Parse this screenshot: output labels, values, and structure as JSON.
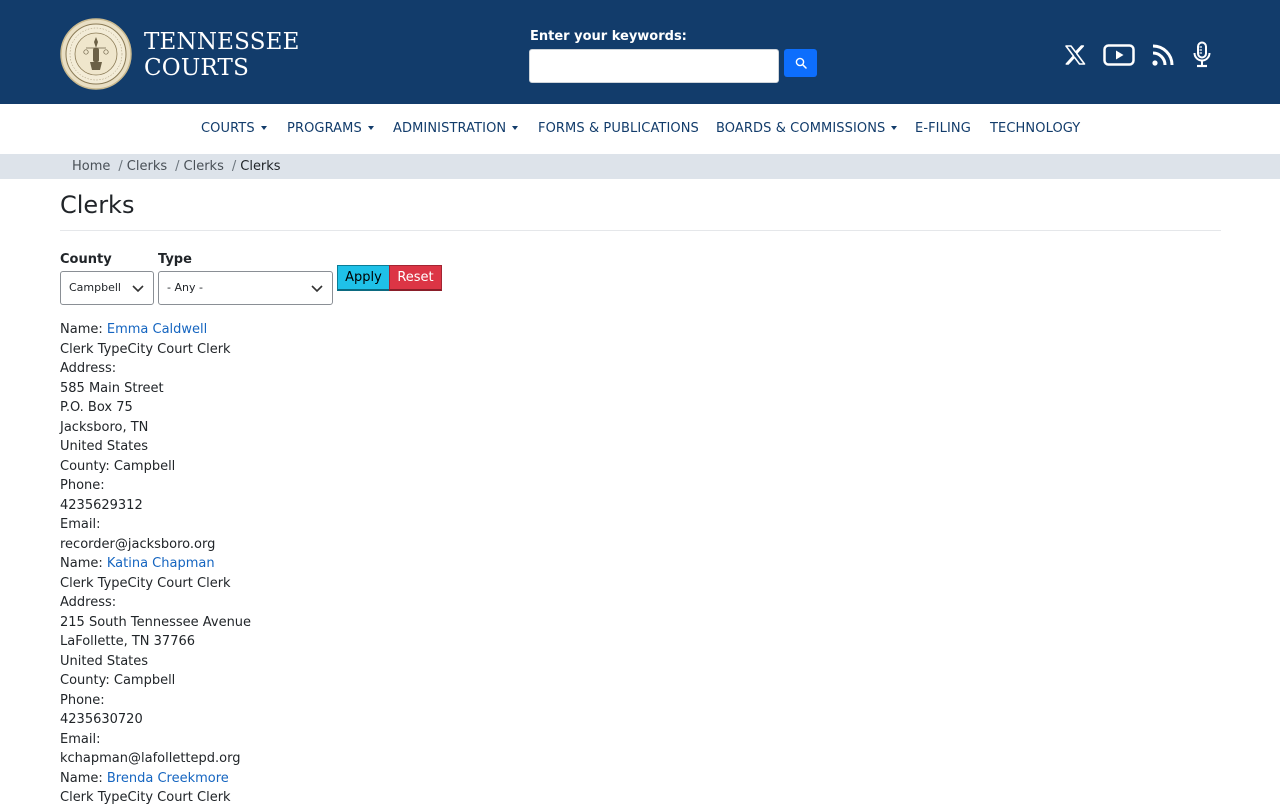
{
  "header": {
    "seal_icon": "tennessee-judiciary-seal",
    "brand_line1": "TENNESSEE",
    "brand_line2": "COURTS",
    "search_label": "Enter your keywords:",
    "search_value": "",
    "search_icon": "search-icon",
    "social_icons": [
      "x-icon",
      "youtube-icon",
      "rss-icon",
      "podcast-icon"
    ]
  },
  "nav": {
    "items": [
      {
        "label": "COURTS",
        "dropdown": true
      },
      {
        "label": "PROGRAMS",
        "dropdown": true
      },
      {
        "label": "ADMINISTRATION",
        "dropdown": true
      },
      {
        "label": "FORMS & PUBLICATIONS",
        "dropdown": false
      },
      {
        "label": "BOARDS & COMMISSIONS",
        "dropdown": true
      },
      {
        "label": "E-FILING",
        "dropdown": false
      },
      {
        "label": "TECHNOLOGY",
        "dropdown": false
      }
    ]
  },
  "breadcrumb": {
    "items": [
      "Home",
      "Clerks",
      "Clerks"
    ],
    "current": "Clerks",
    "separator": "/"
  },
  "page": {
    "title": "Clerks"
  },
  "filters": {
    "county_label": "County",
    "county_value": "Campbell",
    "type_label": "Type",
    "type_value": "- Any -",
    "apply_label": "Apply",
    "reset_label": "Reset"
  },
  "clerks": [
    {
      "name_prefix": "Name: ",
      "name": "Emma Caldwell",
      "type_line": "Clerk TypeCity Court Clerk",
      "address_label": "Address:",
      "address_line1": "585 Main Street",
      "address_line2": "P.O. Box 75",
      "address_line3": "Jacksboro, TN",
      "country": "United States",
      "county_line": "County: Campbell",
      "phone_label": "Phone:",
      "phone": "4235629312",
      "email_label": "Email:",
      "email": "recorder@jacksboro.org"
    },
    {
      "name_prefix": "Name: ",
      "name": "Katina Chapman",
      "type_line": "Clerk TypeCity Court Clerk",
      "address_label": "Address:",
      "address_line1": "215 South Tennessee Avenue",
      "address_line2": "LaFollette, TN 37766",
      "country": "United States",
      "county_line": "County: Campbell",
      "phone_label": "Phone:",
      "phone": "4235630720",
      "email_label": "Email:",
      "email": "kchapman@lafollettepd.org"
    },
    {
      "name_prefix": "Name: ",
      "name": "Brenda Creekmore",
      "type_line": "Clerk TypeCity Court Clerk"
    }
  ],
  "colors": {
    "header_bg": "#123c6b",
    "link": "#1565c0",
    "apply_bg": "#1fc1e8",
    "reset_bg": "#dc3545",
    "search_btn": "#0d6efd"
  }
}
